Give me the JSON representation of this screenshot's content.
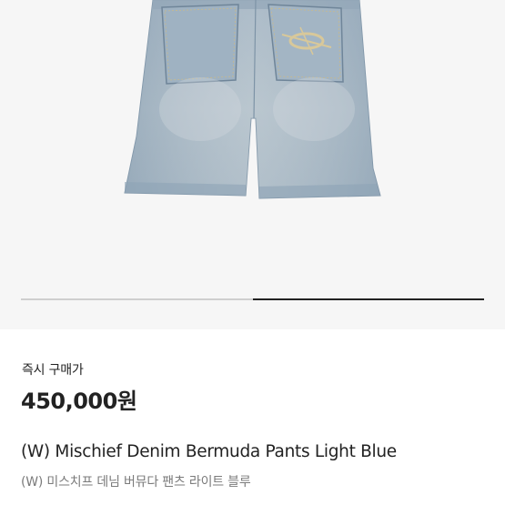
{
  "product": {
    "image_alt": "",
    "price_label": "즉시 구매가",
    "price": "450,000원",
    "title_en": "(W) Mischief Denim Bermuda Pants Light Blue",
    "title_ko": "(W) 미스치프 데님 버뮤다 팬츠 라이트 블루"
  },
  "carousel": {
    "slide_count": 2,
    "current_slide": 2,
    "progress_fraction_start": 0.5,
    "progress_fraction_end": 1.0
  },
  "colors": {
    "denim": "#a9bccb",
    "denim_dark": "#8fa4b6",
    "hero_bg": "#f6f6f6",
    "track": "#cfcfcf",
    "track_active": "#222222"
  },
  "icons": {
    "back_pocket_logo": "oval-cross-logo-icon"
  }
}
